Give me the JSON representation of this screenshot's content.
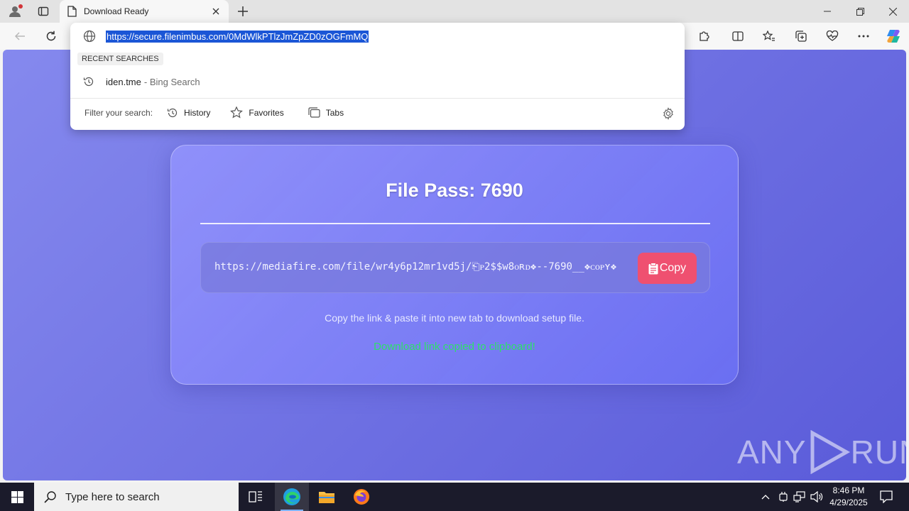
{
  "browser": {
    "tab_title": "Download Ready",
    "address_url": "https://secure.filenimbus.com/0MdWlkPTlzJmZpZD0zOGFmMQ",
    "dropdown": {
      "section_label": "RECENT SEARCHES",
      "recent_term": "iden.tme",
      "recent_source": "- Bing Search",
      "filter_label": "Filter your search:",
      "filters": [
        "History",
        "Favorites",
        "Tabs"
      ]
    }
  },
  "page": {
    "title": "File Pass: 7690",
    "link": "https://mediafire.com/file/wr4y6p12mr1vd5j/⎗ᴘ2$$w8ᴏʀᴅ❖--7690__❖ᴄᴏᴘʏ❖",
    "copy_label": "Copy",
    "instruction": "Copy the link & paste it into new tab to download setup file.",
    "status": "Download link copied to clipboard!",
    "colors": {
      "copy_button": "#ef5070",
      "status": "#2ee06a"
    }
  },
  "watermark": {
    "left": "ANY",
    "right": "RUN"
  },
  "taskbar": {
    "search_placeholder": "Type here to search",
    "time": "8:46 PM",
    "date": "4/29/2025"
  }
}
